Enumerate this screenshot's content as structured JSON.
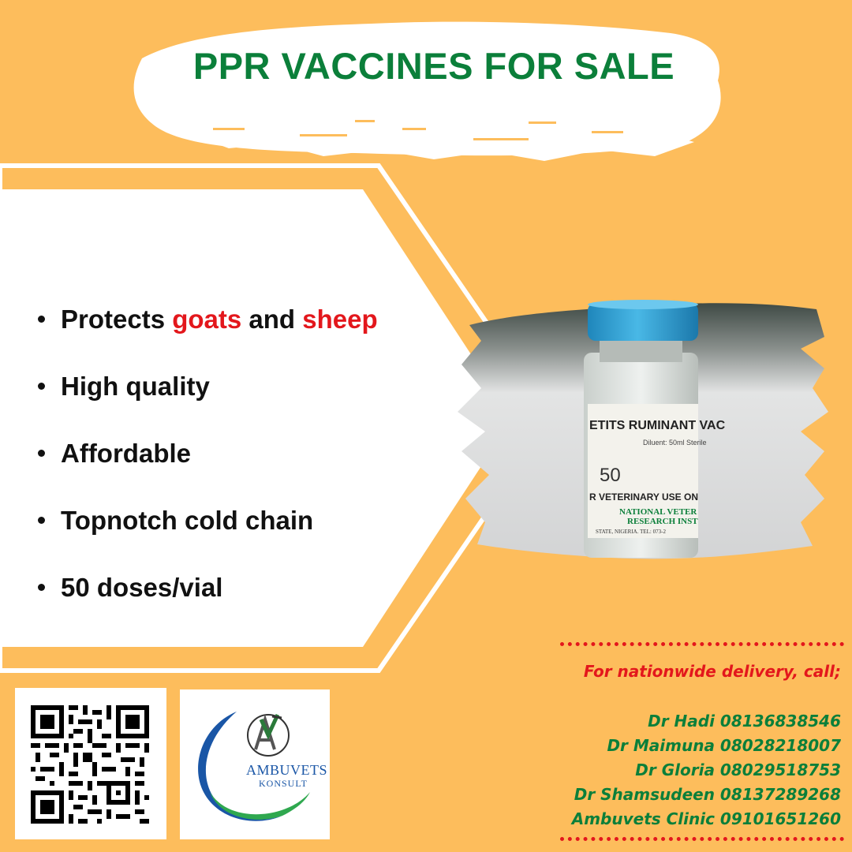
{
  "title": "PPR VACCINES FOR SALE",
  "bullets": {
    "protects_prefix": "Protects ",
    "protects_goats": "goats",
    "protects_and": " and ",
    "protects_sheep": "sheep",
    "items": [
      "High quality",
      "Affordable",
      "Topnotch cold chain",
      "50 doses/vial"
    ]
  },
  "vial_label": {
    "line1": "ETITS RUMINANT VAC",
    "line2": "Diluent: 50ml Sterile",
    "dose": "50",
    "line3": "R VETERINARY USE ON",
    "line4": "NATIONAL VETER",
    "line5": "RESEARCH INST",
    "line6": "STATE, NIGERIA. TEL: 073-2"
  },
  "contact": {
    "intro": "For nationwide delivery, call;",
    "people": [
      "Dr Hadi 08136838546",
      "Dr Maimuna 08028218007",
      "Dr Gloria 08029518753",
      "Dr Shamsudeen 08137289268",
      "Ambuvets Clinic 09101651260"
    ]
  },
  "logo": {
    "name": "AMBUVETS",
    "sub": "KONSULT"
  },
  "colors": {
    "background": "#fdbd5c",
    "title_green": "#0b7f3a",
    "accent_red": "#e3171c",
    "cap_blue": "#2aa3d8"
  },
  "icons": [
    "qr-code-icon",
    "ambuvets-logo-icon"
  ]
}
